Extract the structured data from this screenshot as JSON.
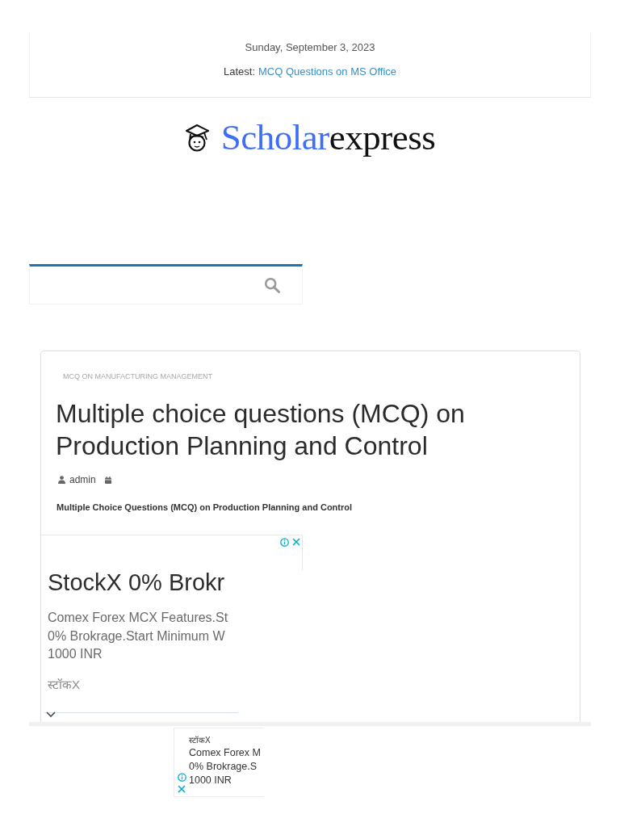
{
  "top_bar": {
    "date": "Sunday, September 3, 2023",
    "latest_label": "Latest:",
    "latest_link": "MCQ Questions on MS Office"
  },
  "brand": {
    "first": "Scholar",
    "second": "express"
  },
  "article": {
    "category": "MCQ ON MANUFACTURING MANAGEMENT",
    "title": "Multiple choice questions (MCQ) on Production Planning and Control",
    "author": "admin",
    "excerpt": "Multiple Choice Questions (MCQ) on Production Planning and Control"
  },
  "ad": {
    "headline": "StockX 0% Brokr",
    "body_lines": [
      "Comex Forex MCX Features.St",
      "0% Brokrage.Start Minimum W",
      "1000 INR"
    ],
    "advertiser": "स्टॉकX"
  },
  "sticky_ad": {
    "advertiser": "स्टॉकX",
    "body_lines": [
      "Comex Forex M",
      "0% Brokrage.S",
      "1000 INR"
    ]
  }
}
